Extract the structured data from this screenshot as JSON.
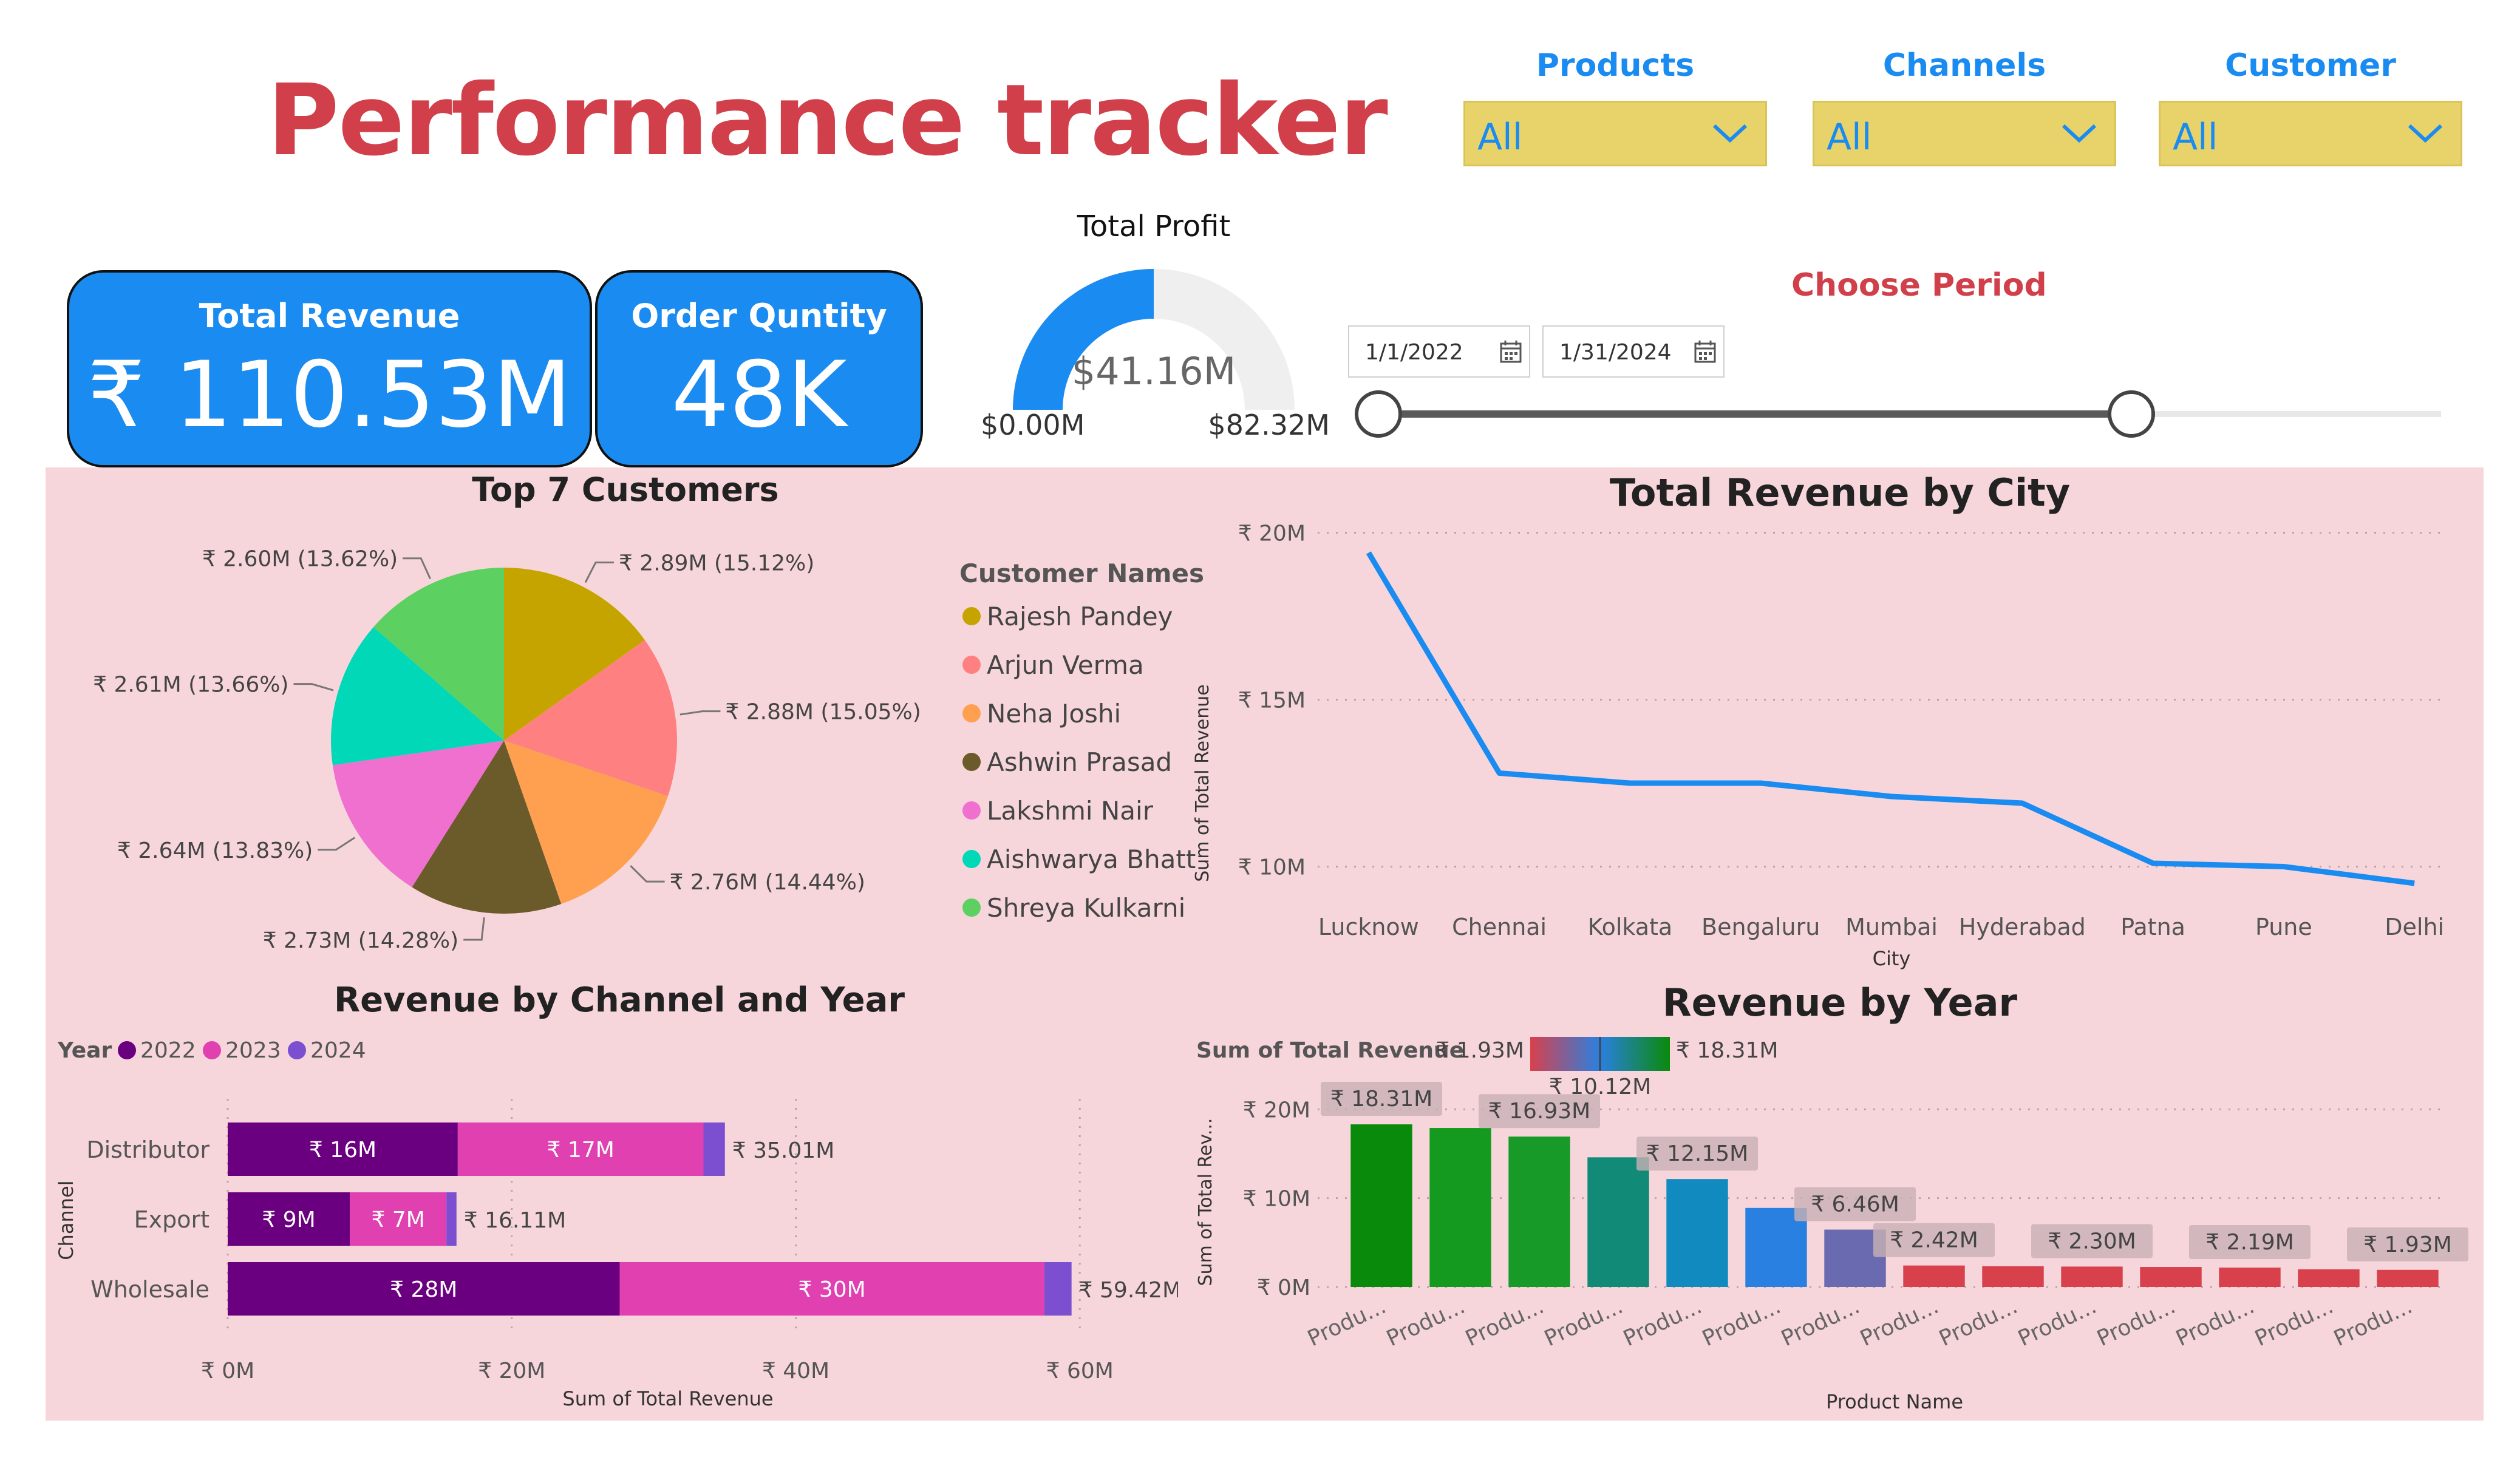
{
  "header": {
    "title": "Performance tracker"
  },
  "slicers": [
    {
      "label": "Products",
      "value": "All"
    },
    {
      "label": "Channels",
      "value": "All"
    },
    {
      "label": "Customer",
      "value": "All"
    }
  ],
  "kpis": {
    "revenue_label": "Total Revenue",
    "revenue_value": "₹ 110.53M",
    "qty_label": "Order Quntity",
    "qty_value": "48K"
  },
  "gauge": {
    "title": "Total Profit",
    "value_text": "$41.16M",
    "min_text": "$0.00M",
    "max_text": "$82.32M",
    "value": 41.16,
    "min": 0,
    "max": 82.32,
    "colors": {
      "fill": "#1a8bf0",
      "track": "#efefef"
    }
  },
  "period": {
    "title": "Choose Period",
    "start": "1/1/2022",
    "end": "1/31/2024"
  },
  "chart_data": [
    {
      "type": "pie",
      "title": "Top 7 Customers",
      "legend_title": "Customer Names",
      "legend_position": "right",
      "slices": [
        {
          "name": "Rajesh Pandey",
          "value": 2.89,
          "label": "₹ 2.89M (15.12%)",
          "color": "#c6a400"
        },
        {
          "name": "Arjun Verma",
          "value": 2.88,
          "label": "₹ 2.88M (15.05%)",
          "color": "#ff8080"
        },
        {
          "name": "Neha Joshi",
          "value": 2.76,
          "label": "₹ 2.76M (14.44%)",
          "color": "#ffa050"
        },
        {
          "name": "Ashwin Prasad",
          "value": 2.73,
          "label": "₹ 2.73M (14.28%)",
          "color": "#6b5a2a"
        },
        {
          "name": "Lakshmi Nair",
          "value": 2.64,
          "label": "₹ 2.64M (13.83%)",
          "color": "#f070d0"
        },
        {
          "name": "Aishwarya Bhatt",
          "value": 2.61,
          "label": "₹ 2.61M (13.66%)",
          "color": "#00d8b8"
        },
        {
          "name": "Shreya Kulkarni",
          "value": 2.6,
          "label": "₹ 2.60M (13.62%)",
          "color": "#5cd060"
        }
      ]
    },
    {
      "type": "line",
      "title": "Total Revenue by City",
      "xlabel": "City",
      "ylabel": "Sum of Total Revenue",
      "categories": [
        "Lucknow",
        "Chennai",
        "Kolkata",
        "Bengaluru",
        "Mumbai",
        "Hyderabad",
        "Patna",
        "Pune",
        "Delhi"
      ],
      "values": [
        19.4,
        12.8,
        12.5,
        12.5,
        12.1,
        11.9,
        10.1,
        10.0,
        9.5
      ],
      "yticks": [
        {
          "v": 10,
          "label": "₹ 10M"
        },
        {
          "v": 15,
          "label": "₹ 15M"
        },
        {
          "v": 20,
          "label": "₹ 20M"
        }
      ],
      "ylim": [
        8.5,
        20.5
      ],
      "grid": true,
      "color": "#1a8bf0"
    },
    {
      "type": "bar",
      "orientation": "horizontal",
      "stacked": true,
      "title": "Revenue by Channel and Year",
      "legend_title": "Year",
      "legend_position": "top-left",
      "xlabel": "Sum of Total Revenue",
      "ylabel": "Channel",
      "categories": [
        "Distributor",
        "Export",
        "Wholesale"
      ],
      "totals": [
        "₹ 35.01M",
        "₹ 16.11M",
        "₹ 59.42M"
      ],
      "series": [
        {
          "name": "2022",
          "color": "#6a0080",
          "values": [
            16.2,
            8.6,
            27.6
          ],
          "labels": [
            "₹ 16M",
            "₹ 9M",
            "₹ 28M"
          ]
        },
        {
          "name": "2023",
          "color": "#e040b0",
          "values": [
            17.3,
            6.8,
            29.9
          ],
          "labels": [
            "₹ 17M",
            "₹ 7M",
            "₹ 30M"
          ]
        },
        {
          "name": "2024",
          "color": "#7b4fd0",
          "values": [
            1.51,
            0.71,
            1.92
          ],
          "labels": [
            "",
            "",
            ""
          ]
        }
      ],
      "xticks": [
        {
          "v": 0,
          "label": "₹ 0M"
        },
        {
          "v": 20,
          "label": "₹ 20M"
        },
        {
          "v": 40,
          "label": "₹ 40M"
        },
        {
          "v": 60,
          "label": "₹ 60M"
        }
      ],
      "xlim": [
        0,
        62
      ],
      "grid": true
    },
    {
      "type": "bar",
      "title": "Revenue by Year",
      "xlabel": "Product Name",
      "ylabel": "Sum of Total Rev...",
      "color_legend": {
        "title": "Sum of Total Revenue",
        "min_label": "₹ 1.93M",
        "mid_label": "₹ 10.12M",
        "max_label": "₹ 18.31M"
      },
      "categories": [
        "Produ...",
        "Produ...",
        "Produ...",
        "Produ...",
        "Produ...",
        "Produ...",
        "Produ...",
        "Produ...",
        "Produ...",
        "Produ...",
        "Produ...",
        "Produ...",
        "Produ...",
        "Produ..."
      ],
      "values": [
        18.31,
        17.9,
        16.93,
        14.6,
        12.15,
        8.9,
        6.46,
        2.42,
        2.35,
        2.3,
        2.25,
        2.19,
        2.0,
        1.93
      ],
      "labels": [
        "₹ 18.31M",
        "",
        "₹ 16.93M",
        "",
        "₹ 12.15M",
        "",
        "₹ 6.46M",
        "₹ 2.42M",
        "",
        "₹ 2.30M",
        "",
        "₹ 2.19M",
        "",
        "₹ 1.93M"
      ],
      "colors": [
        "#0a8a0a",
        "#149a1e",
        "#189a28",
        "#118a78",
        "#118ac0",
        "#2a80e0",
        "#6a6ab0",
        "#d8404c",
        "#d8404c",
        "#d8404c",
        "#d8404c",
        "#d8404c",
        "#d8404c",
        "#d8404c"
      ],
      "yticks": [
        {
          "v": 0,
          "label": "₹ 0M"
        },
        {
          "v": 10,
          "label": "₹ 10M"
        },
        {
          "v": 20,
          "label": "₹ 20M"
        }
      ],
      "ylim": [
        0,
        20.5
      ],
      "grid": true
    }
  ]
}
